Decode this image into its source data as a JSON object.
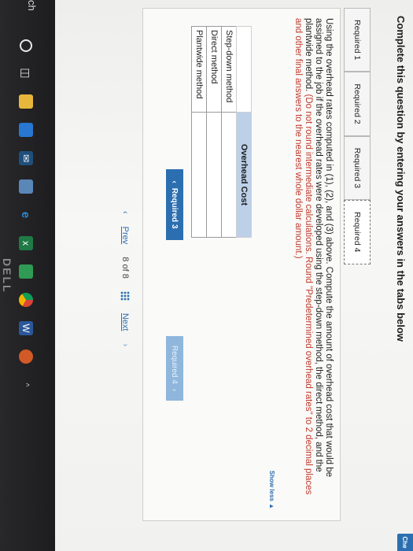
{
  "header": {
    "instruction": "Complete this question by entering your answers in the tabs below",
    "check_button": "Che"
  },
  "tabs": [
    {
      "label": "Required 1"
    },
    {
      "label": "Required 2"
    },
    {
      "label": "Required 3"
    },
    {
      "label": "Required 4",
      "active": true
    }
  ],
  "question": {
    "text_main": "Using the overhead rates computed in (1), (2), and (3) above. Compute the amount of overhead cost that would be assigned to the job if the overhead rates were developed using the step-down method, the direct method, and the plantwide method. ",
    "text_hint": "(Do not round intermediate calculations. Round \"Predetermined overhead rates\" to 2 decimal places and other final answers to the nearest whole dollar amount.)",
    "show_less": "Show less ▲"
  },
  "table": {
    "column_header": "Overhead Cost",
    "rows": [
      {
        "label": "Step-down method",
        "value": ""
      },
      {
        "label": "Direct method",
        "value": ""
      },
      {
        "label": "Plantwide method",
        "value": ""
      }
    ]
  },
  "navigation": {
    "prev_label": "Required 3",
    "next_label": "Required 4"
  },
  "pager": {
    "prev": "Prev",
    "page_current": "8",
    "page_of": "of",
    "page_total": "8",
    "next": "Next"
  },
  "taskbar": {
    "search_fragment": "ch"
  },
  "bezel": {
    "logo": "DELL"
  }
}
